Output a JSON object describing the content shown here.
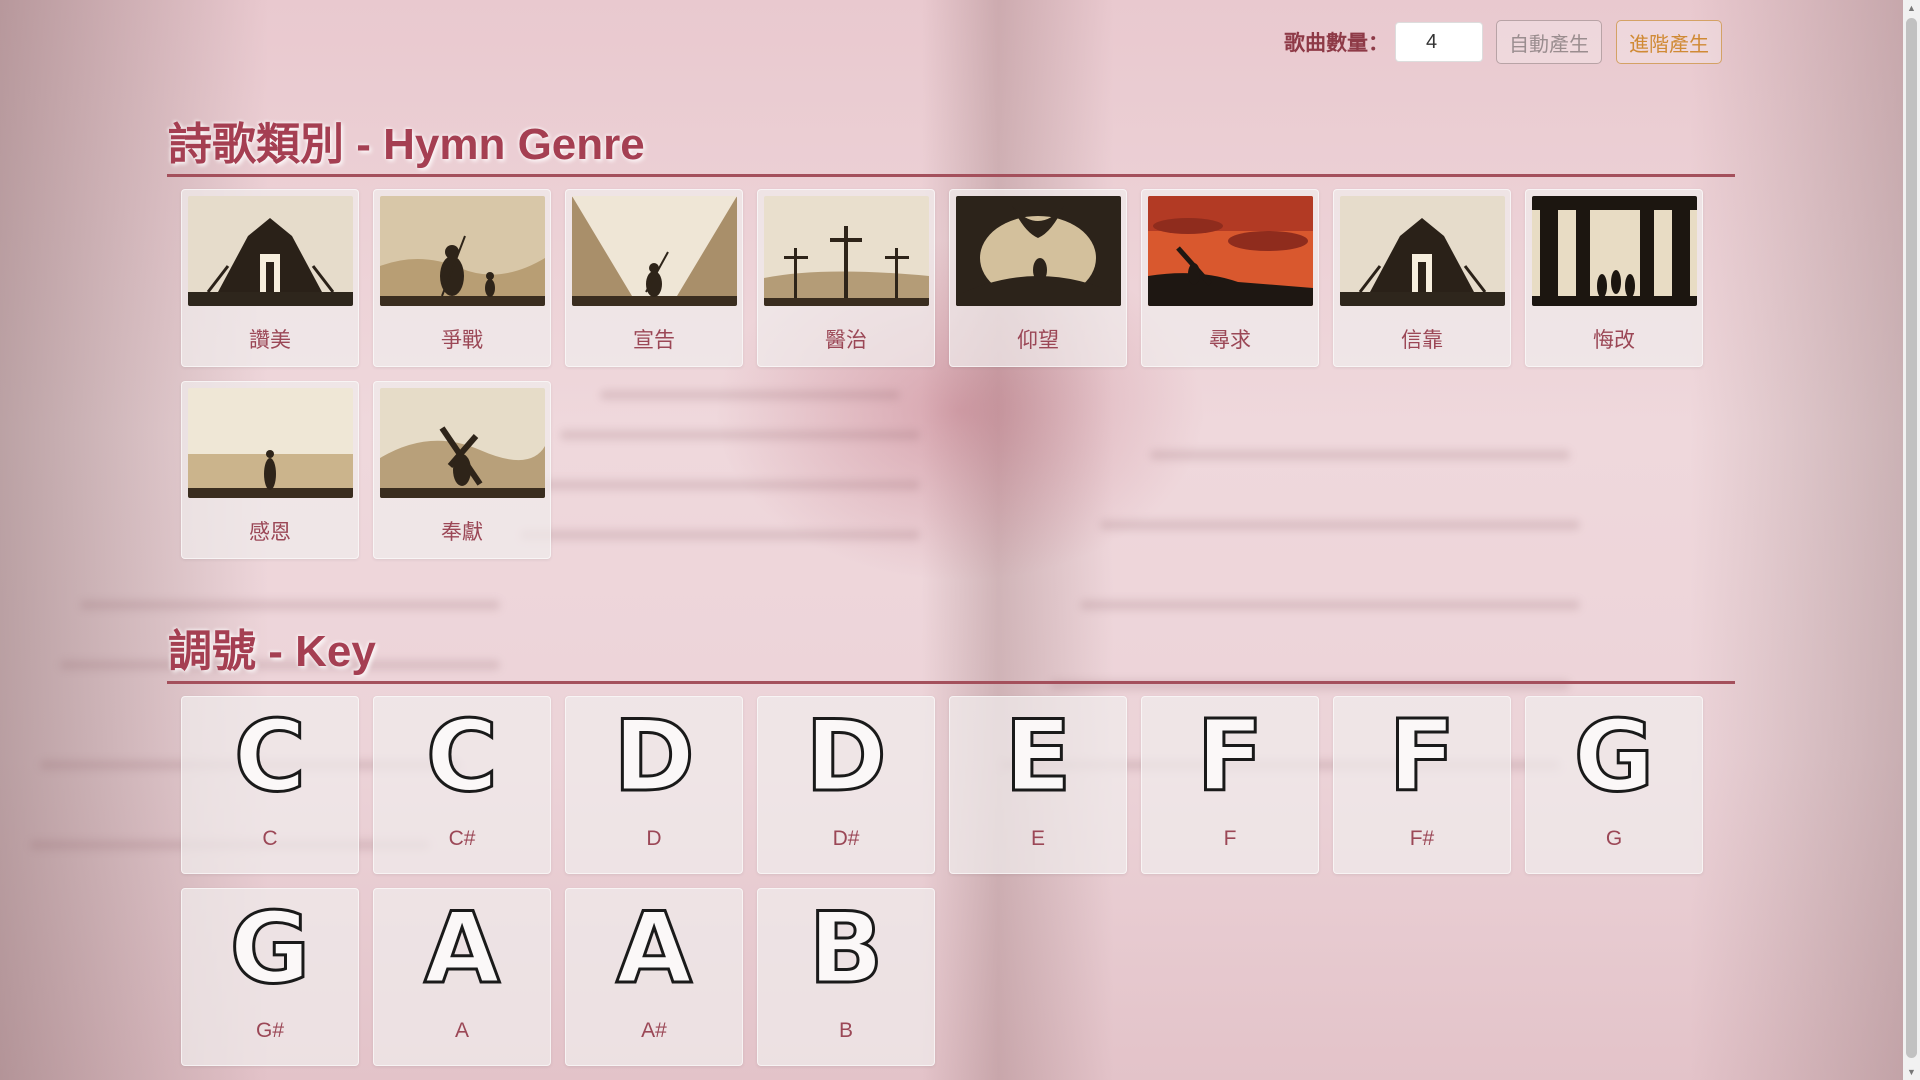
{
  "controls": {
    "count_label": "歌曲數量：",
    "count_value": "4",
    "auto_button": "自動產生",
    "advanced_button": "進階產生"
  },
  "genre_section": {
    "title": "詩歌類別 - Hymn Genre",
    "items": [
      {
        "label": "讚美",
        "image": "ark-silhouette"
      },
      {
        "label": "爭戰",
        "image": "david-goliath"
      },
      {
        "label": "宣告",
        "image": "warrior-valley"
      },
      {
        "label": "醫治",
        "image": "three-crosses"
      },
      {
        "label": "仰望",
        "image": "jonah-whale"
      },
      {
        "label": "尋求",
        "image": "cross-bearer-sunset"
      },
      {
        "label": "信靠",
        "image": "ark-silhouette"
      },
      {
        "label": "悔改",
        "image": "fiery-furnace"
      },
      {
        "label": "感恩",
        "image": "harvest-field"
      },
      {
        "label": "奉獻",
        "image": "cross-bearer-hills"
      }
    ]
  },
  "key_section": {
    "title": "調號 - Key",
    "items": [
      {
        "glyph": "C",
        "label": "C"
      },
      {
        "glyph": "C",
        "label": "C#"
      },
      {
        "glyph": "D",
        "label": "D"
      },
      {
        "glyph": "D",
        "label": "D#"
      },
      {
        "glyph": "E",
        "label": "E"
      },
      {
        "glyph": "F",
        "label": "F"
      },
      {
        "glyph": "F",
        "label": "F#"
      },
      {
        "glyph": "G",
        "label": "G"
      },
      {
        "glyph": "G",
        "label": "G#"
      },
      {
        "glyph": "A",
        "label": "A"
      },
      {
        "glyph": "A",
        "label": "A#"
      },
      {
        "glyph": "B",
        "label": "B"
      }
    ]
  },
  "colors": {
    "title": "#a53f52",
    "label": "#9b4756",
    "advanced_accent": "#d08a35"
  }
}
